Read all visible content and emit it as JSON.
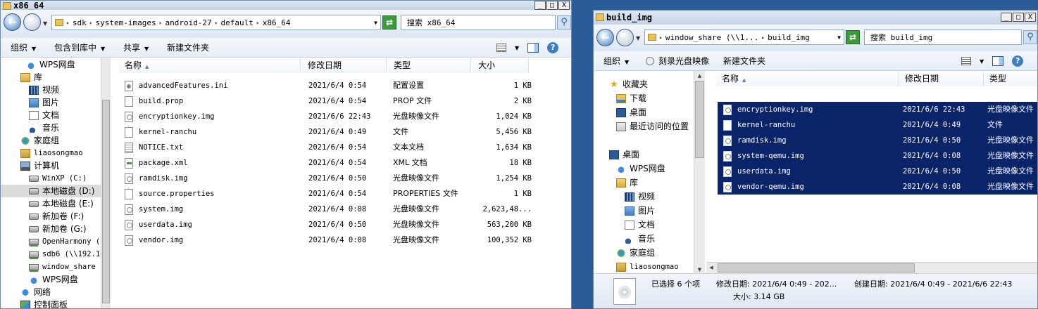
{
  "left_window": {
    "title": "x86_64",
    "caption_buttons": [
      "_",
      "□",
      "X"
    ],
    "address": {
      "crumbs": [
        "sdk",
        "system-images",
        "android-27",
        "default",
        "x86_64"
      ]
    },
    "search_placeholder": "搜索 x86_64",
    "toolbar": {
      "organize": "组织",
      "include_in_library": "包含到库中",
      "share": "共享",
      "new_folder": "新建文件夹"
    },
    "nav_items": [
      {
        "label": "WPS网盘",
        "icon": "cloud-icon",
        "indent": 36
      },
      {
        "label": "库",
        "icon": "library-icon",
        "indent": 28
      },
      {
        "label": "视频",
        "icon": "video-icon",
        "indent": 40
      },
      {
        "label": "图片",
        "icon": "pictures-icon",
        "indent": 40
      },
      {
        "label": "文档",
        "icon": "documents-icon",
        "indent": 40
      },
      {
        "label": "音乐",
        "icon": "music-icon",
        "indent": 40
      },
      {
        "label": "家庭组",
        "icon": "homegroup-icon",
        "indent": 28
      },
      {
        "label": "liaosongmao",
        "icon": "user-folder-icon",
        "indent": 28,
        "mono": true
      },
      {
        "label": "计算机",
        "icon": "computer-icon",
        "indent": 28
      },
      {
        "label": "WinXP (C:)",
        "icon": "drive-icon",
        "indent": 40,
        "mono": true
      },
      {
        "label": "本地磁盘 (D:)",
        "icon": "drive-icon",
        "indent": 40,
        "selected": true
      },
      {
        "label": "本地磁盘 (E:)",
        "icon": "drive-icon",
        "indent": 40
      },
      {
        "label": "新加卷 (F:)",
        "icon": "drive-icon",
        "indent": 40
      },
      {
        "label": "新加卷 (G:)",
        "icon": "drive-icon",
        "indent": 40
      },
      {
        "label": "OpenHarmony (",
        "icon": "network-drive-icon",
        "indent": 40,
        "mono": true
      },
      {
        "label": "sdb6 (\\\\192.16",
        "icon": "network-drive-icon",
        "indent": 40,
        "mono": true
      },
      {
        "label": "window_share",
        "icon": "network-drive-icon",
        "indent": 40,
        "mono": true
      },
      {
        "label": "WPS网盘",
        "icon": "cloud-icon",
        "indent": 40
      },
      {
        "label": "网络",
        "icon": "network-icon",
        "indent": 28
      },
      {
        "label": "控制面板",
        "icon": "control-panel-icon",
        "indent": 28
      }
    ],
    "columns": [
      "名称",
      "修改日期",
      "类型",
      "大小"
    ],
    "files": [
      {
        "name": "advancedFeatures.ini",
        "date": "2021/6/4 0:54",
        "type": "配置设置",
        "size": "1 KB",
        "icon": "config-file-icon"
      },
      {
        "name": "build.prop",
        "date": "2021/6/4 0:54",
        "type": "PROP 文件",
        "size": "2 KB",
        "icon": "file-icon"
      },
      {
        "name": "encryptionkey.img",
        "date": "2021/6/6 22:43",
        "type": "光盘映像文件",
        "size": "1,024 KB",
        "icon": "disc-image-icon"
      },
      {
        "name": "kernel-ranchu",
        "date": "2021/6/4 0:49",
        "type": "文件",
        "size": "5,456 KB",
        "icon": "file-icon"
      },
      {
        "name": "NOTICE.txt",
        "date": "2021/6/4 0:54",
        "type": "文本文档",
        "size": "1,634 KB",
        "icon": "text-file-icon"
      },
      {
        "name": "package.xml",
        "date": "2021/6/4 0:54",
        "type": "XML 文档",
        "size": "18 KB",
        "icon": "xml-file-icon"
      },
      {
        "name": "ramdisk.img",
        "date": "2021/6/4 0:50",
        "type": "光盘映像文件",
        "size": "1,254 KB",
        "icon": "disc-image-icon"
      },
      {
        "name": "source.properties",
        "date": "2021/6/4 0:54",
        "type": "PROPERTIES 文件",
        "size": "1 KB",
        "icon": "file-icon"
      },
      {
        "name": "system.img",
        "date": "2021/6/4 0:08",
        "type": "光盘映像文件",
        "size": "2,623,48...",
        "icon": "disc-image-icon"
      },
      {
        "name": "userdata.img",
        "date": "2021/6/4 0:50",
        "type": "光盘映像文件",
        "size": "563,200 KB",
        "icon": "disc-image-icon"
      },
      {
        "name": "vendor.img",
        "date": "2021/6/4 0:08",
        "type": "光盘映像文件",
        "size": "100,352 KB",
        "icon": "disc-image-icon"
      }
    ]
  },
  "right_window": {
    "title": "build_img",
    "caption_buttons": [
      "_",
      "□",
      "X"
    ],
    "address": {
      "crumbs": [
        "window_share (\\\\1...",
        "build_img"
      ]
    },
    "search_placeholder": "搜索 build_img",
    "toolbar": {
      "organize": "组织",
      "burn": "刻录光盘映像",
      "new_folder": "新建文件夹"
    },
    "nav_items": [
      {
        "label": "收藏夹",
        "icon": "favorites-star-icon",
        "indent": 22
      },
      {
        "label": "下载",
        "icon": "downloads-icon",
        "indent": 32
      },
      {
        "label": "桌面",
        "icon": "desktop-icon",
        "indent": 32
      },
      {
        "label": "最近访问的位置",
        "icon": "recent-places-icon",
        "indent": 32
      },
      {
        "label": "桌面",
        "icon": "desktop-icon",
        "indent": 22
      },
      {
        "label": "WPS网盘",
        "icon": "cloud-icon",
        "indent": 32
      },
      {
        "label": "库",
        "icon": "library-icon",
        "indent": 32
      },
      {
        "label": "视频",
        "icon": "video-icon",
        "indent": 44
      },
      {
        "label": "图片",
        "icon": "pictures-icon",
        "indent": 44
      },
      {
        "label": "文档",
        "icon": "documents-icon",
        "indent": 44
      },
      {
        "label": "音乐",
        "icon": "music-icon",
        "indent": 44
      },
      {
        "label": "家庭组",
        "icon": "homegroup-icon",
        "indent": 32
      },
      {
        "label": "liaosongmao",
        "icon": "user-folder-icon",
        "indent": 32,
        "mono": true
      }
    ],
    "columns": [
      "名称",
      "修改日期",
      "类型"
    ],
    "files": [
      {
        "name": "encryptionkey.img",
        "date": "2021/6/6 22:43",
        "type": "光盘映像文件",
        "icon": "disc-image-icon"
      },
      {
        "name": "kernel-ranchu",
        "date": "2021/6/4 0:49",
        "type": "文件",
        "icon": "file-icon"
      },
      {
        "name": "ramdisk.img",
        "date": "2021/6/4 0:50",
        "type": "光盘映像文件",
        "icon": "disc-image-icon"
      },
      {
        "name": "system-qemu.img",
        "date": "2021/6/4 0:08",
        "type": "光盘映像文件",
        "icon": "disc-image-icon"
      },
      {
        "name": "userdata.img",
        "date": "2021/6/4 0:50",
        "type": "光盘映像文件",
        "icon": "disc-image-icon"
      },
      {
        "name": "vendor-qemu.img",
        "date": "2021/6/4 0:08",
        "type": "光盘映像文件",
        "icon": "disc-image-icon"
      }
    ],
    "details": {
      "selected_count": "已选择 6 个项",
      "modified": "修改日期: 2021/6/4 0:49 - 202...",
      "created": "创建日期: 2021/6/4 0:49 - 2021/6/6 22:43",
      "size": "大小: 3.14 GB"
    }
  },
  "colors": {
    "selection": "#0a246a",
    "desktop": "#2a5c99",
    "accent": "#3f7fc0"
  }
}
